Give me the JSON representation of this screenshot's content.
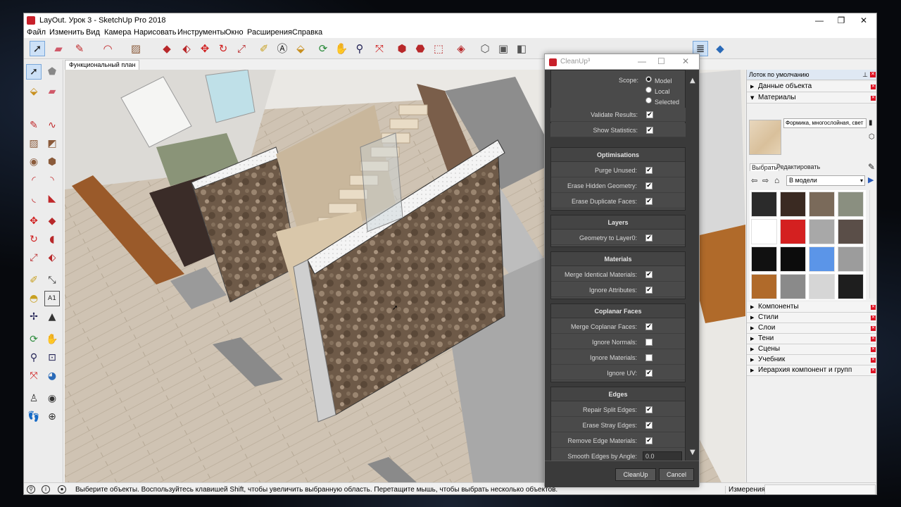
{
  "window": {
    "title": "LayOut. Урок 3 - SketchUp Pro 2018",
    "minimize": "—",
    "restore": "❐",
    "close": "✕"
  },
  "menu": [
    "Файл",
    "Изменить",
    "Вид",
    "Камера",
    "Нарисовать",
    "Инструменты",
    "Окно",
    "Расширения",
    "Справка"
  ],
  "scene_tab": "Функциональный план",
  "tray": {
    "title": "Лоток по умолчанию",
    "sections_top": [
      "Данные объекта",
      "Материалы"
    ],
    "material_name": "Формика, многослойная, свет",
    "tabs": [
      "Выбрать",
      "Редактировать"
    ],
    "library": "В модели",
    "swatch_colors": [
      "#2b2b2b",
      "#3a2a22",
      "#7a6a5a",
      "#8a8f80",
      "#ffffff",
      "#d42020",
      "#a8a8a8",
      "#5a4e48",
      "#111111",
      "#0c0c0c",
      "#5b95e8",
      "#9c9c9c",
      "#b06a2a",
      "#8a8a8a",
      "#d6d6d6",
      "#1e1e1e"
    ],
    "sections_bottom": [
      "Компоненты",
      "Стили",
      "Слои",
      "Тени",
      "Сцены",
      "Учебник",
      "Иерархия компонент и групп"
    ]
  },
  "status": {
    "message": "Выберите объекты. Воспользуйтесь клавишей Shift, чтобы увеличить выбранную область. Перетащите мышь, чтобы выбрать несколько объектов.",
    "measurements_label": "Измерения"
  },
  "cleanup": {
    "title": "CleanUp³",
    "scope_label": "Scope:",
    "scope_options": [
      {
        "label": "Model",
        "selected": true
      },
      {
        "label": "Local",
        "selected": false
      },
      {
        "label": "Selected",
        "selected": false
      }
    ],
    "general": [
      {
        "label": "Validate Results:",
        "checked": true
      },
      {
        "label": "Show Statistics:",
        "checked": true
      }
    ],
    "sections": [
      {
        "title": "Optimisations",
        "items": [
          {
            "label": "Purge Unused:",
            "checked": true
          },
          {
            "label": "Erase Hidden Geometry:",
            "checked": true
          },
          {
            "label": "Erase Duplicate Faces:",
            "checked": true
          }
        ]
      },
      {
        "title": "Layers",
        "items": [
          {
            "label": "Geometry to Layer0:",
            "checked": true
          }
        ]
      },
      {
        "title": "Materials",
        "items": [
          {
            "label": "Merge Identical Materials:",
            "checked": true
          },
          {
            "label": "Ignore Attributes:",
            "checked": true
          }
        ]
      },
      {
        "title": "Coplanar Faces",
        "items": [
          {
            "label": "Merge Coplanar Faces:",
            "checked": true
          },
          {
            "label": "Ignore Normals:",
            "checked": false
          },
          {
            "label": "Ignore Materials:",
            "checked": false
          },
          {
            "label": "Ignore UV:",
            "checked": true
          }
        ]
      },
      {
        "title": "Edges",
        "items": [
          {
            "label": "Repair Split Edges:",
            "checked": true
          },
          {
            "label": "Erase Stray Edges:",
            "checked": true
          },
          {
            "label": "Remove Edge Materials:",
            "checked": true
          }
        ]
      }
    ],
    "smooth_label": "Smooth Edges by Angle:",
    "smooth_value": "0.0",
    "cleanup_button": "CleanUp",
    "cancel_button": "Cancel"
  }
}
